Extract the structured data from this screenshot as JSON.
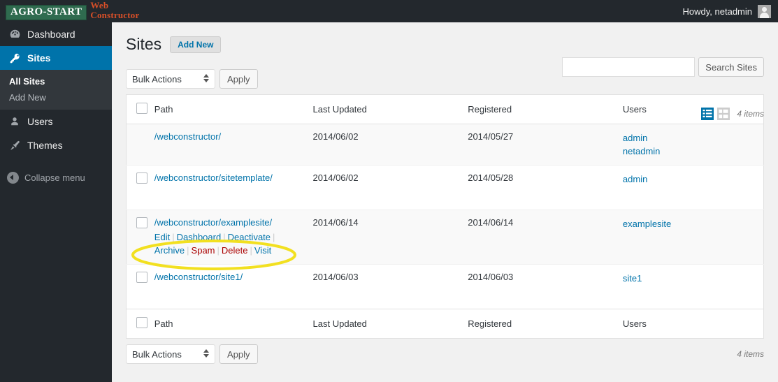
{
  "adminbar": {
    "logo": {
      "brand": "AGRO-START",
      "product_line1": "Web",
      "product_line2": "Constructor"
    },
    "howdy": "Howdy, netadmin",
    "avatar_icon": "user-avatar-icon"
  },
  "sidebar": {
    "items": [
      {
        "label": "Dashboard",
        "icon": "dashboard-gauge-icon",
        "active": false
      },
      {
        "label": "Sites",
        "icon": "key-icon",
        "active": true
      },
      {
        "label": "Users",
        "icon": "user-icon",
        "active": false
      },
      {
        "label": "Themes",
        "icon": "brush-icon",
        "active": false
      }
    ],
    "submenu": [
      {
        "label": "All Sites",
        "current": true
      },
      {
        "label": "Add New",
        "current": false
      }
    ],
    "collapse": {
      "label": "Collapse menu",
      "icon": "collapse-arrow-icon"
    }
  },
  "page": {
    "title": "Sites",
    "add_new_label": "Add New"
  },
  "search": {
    "value": "",
    "placeholder": "",
    "button_label": "Search Sites"
  },
  "viewmodes": {
    "list_icon": "list-view-icon",
    "excerpt_icon": "excerpt-view-icon",
    "items_count": "4 items"
  },
  "tablenav_top": {
    "bulk_label": "Bulk Actions",
    "apply_label": "Apply"
  },
  "tablenav_bottom": {
    "bulk_label": "Bulk Actions",
    "apply_label": "Apply",
    "items_count": "4 items"
  },
  "table": {
    "columns": [
      "Path",
      "Last Updated",
      "Registered",
      "Users"
    ],
    "rows": [
      {
        "checkbox": false,
        "path": "/webconstructor/",
        "last_updated": "2014/06/02",
        "registered": "2014/05/27",
        "users": [
          "admin",
          "netadmin"
        ],
        "actions": []
      },
      {
        "checkbox": true,
        "path": "/webconstructor/sitetemplate/",
        "last_updated": "2014/06/02",
        "registered": "2014/05/28",
        "users": [
          "admin"
        ],
        "actions": []
      },
      {
        "checkbox": true,
        "path": "/webconstructor/examplesite/",
        "last_updated": "2014/06/14",
        "registered": "2014/06/14",
        "users": [
          "examplesite"
        ],
        "actions": [
          {
            "label": "Edit",
            "danger": false
          },
          {
            "label": "Dashboard",
            "danger": false
          },
          {
            "label": "Deactivate",
            "danger": false
          },
          {
            "label": "Archive",
            "danger": false
          },
          {
            "label": "Spam",
            "danger": true
          },
          {
            "label": "Delete",
            "danger": true
          },
          {
            "label": "Visit",
            "danger": false
          }
        ]
      },
      {
        "checkbox": true,
        "path": "/webconstructor/site1/",
        "last_updated": "2014/06/03",
        "registered": "2014/06/03",
        "users": [
          "site1"
        ],
        "actions": []
      }
    ]
  },
  "annotation": {
    "shape": "ellipse",
    "color": "#f2e020",
    "targets": "row-actions of examplesite"
  },
  "colors": {
    "admin_bar": "#23282d",
    "sidebar": "#23282d",
    "active_menu": "#0073aa",
    "link": "#0073aa",
    "danger_link": "#a00",
    "page_background": "#f1f1f1",
    "annotation": "#f2e020"
  }
}
